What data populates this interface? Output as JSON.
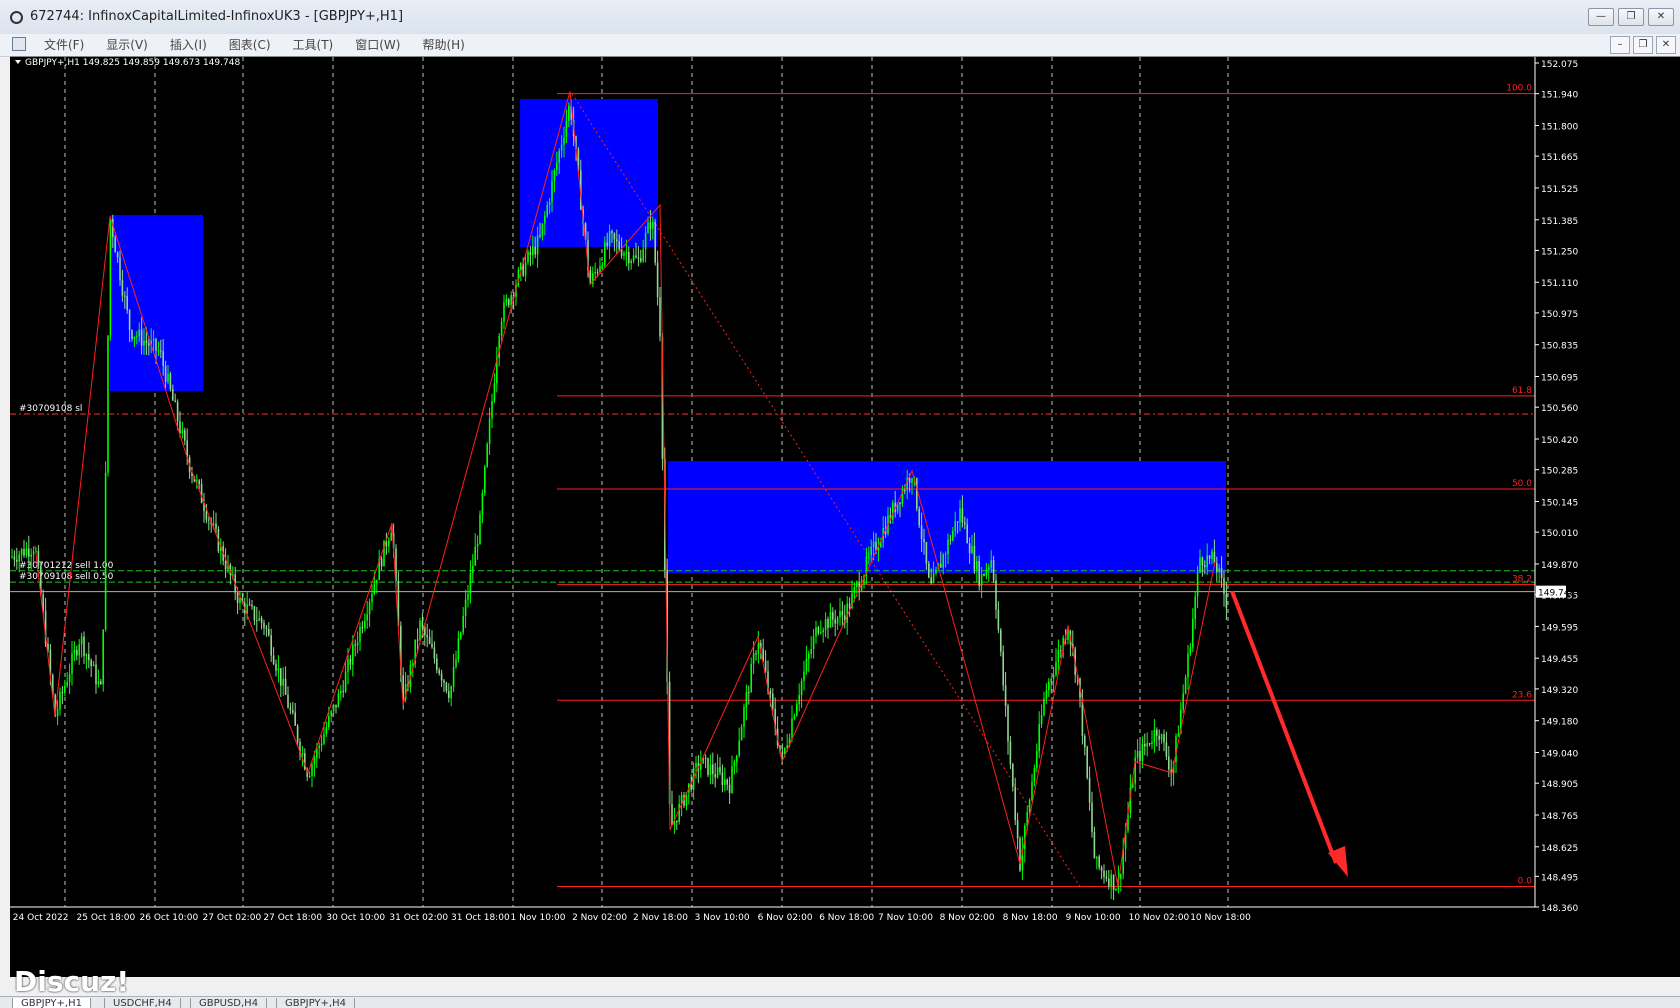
{
  "window": {
    "title": "672744: InfinoxCapitalLimited-InfinoxUK3 - [GBPJPY+,H1]",
    "controls": [
      "—",
      "❐",
      "✕"
    ]
  },
  "menu": [
    "文件(F)",
    "显示(V)",
    "插入(I)",
    "图表(C)",
    "工具(T)",
    "窗口(W)",
    "帮助(H)"
  ],
  "mdi_controls": [
    "–",
    "❐",
    "✕"
  ],
  "chart": {
    "header": "GBPJPY+,H1  149.825 149.859 149.673 149.748",
    "current_price": "149.748",
    "price_ticks": [
      "152.075",
      "151.940",
      "151.800",
      "151.665",
      "151.525",
      "151.385",
      "151.250",
      "151.110",
      "150.975",
      "150.835",
      "150.695",
      "150.560",
      "150.420",
      "150.285",
      "150.145",
      "150.010",
      "149.870",
      "149.735",
      "149.595",
      "149.455",
      "149.320",
      "149.180",
      "149.040",
      "148.905",
      "148.765",
      "148.625",
      "148.495",
      "148.360"
    ],
    "time_ticks": [
      "24 Oct 2022",
      "25 Oct 18:00",
      "26 Oct 10:00",
      "27 Oct 02:00",
      "27 Oct 18:00",
      "30 Oct 10:00",
      "31 Oct 02:00",
      "31 Oct 18:00",
      "1 Nov 10:00",
      "2 Nov 02:00",
      "2 Nov 18:00",
      "3 Nov 10:00",
      "6 Nov 02:00",
      "6 Nov 18:00",
      "7 Nov 10:00",
      "8 Nov 02:00",
      "8 Nov 18:00",
      "9 Nov 10:00",
      "10 Nov 02:00",
      "10 Nov 18:00"
    ],
    "fib_levels": [
      {
        "label": "100.0",
        "price": 151.94
      },
      {
        "label": "61.8",
        "price": 150.61
      },
      {
        "label": "50.0",
        "price": 150.2
      },
      {
        "label": "38.2",
        "price": 149.78
      },
      {
        "label": "23.6",
        "price": 149.27
      },
      {
        "label": "0.0",
        "price": 148.45
      }
    ],
    "order_lines": [
      {
        "label": "#30709108 sl",
        "price": 150.53
      },
      {
        "label": "#30701212 sell 1.00",
        "price": 149.84
      },
      {
        "label": "#30709108 sell 0.50",
        "price": 149.79
      }
    ],
    "colors": {
      "bull": "#00ff00",
      "bear": "#8fd88f",
      "zone": "#0000ff",
      "fib": "#ff2020",
      "grid": "#c0c0c0",
      "arrow": "#ff2a2a"
    }
  },
  "tabs": [
    "GBPJPY+,H1",
    "USDCHF,H4",
    "GBPUSD,H4",
    "GBPJPY+,H4"
  ],
  "watermark": "Discuz!"
}
